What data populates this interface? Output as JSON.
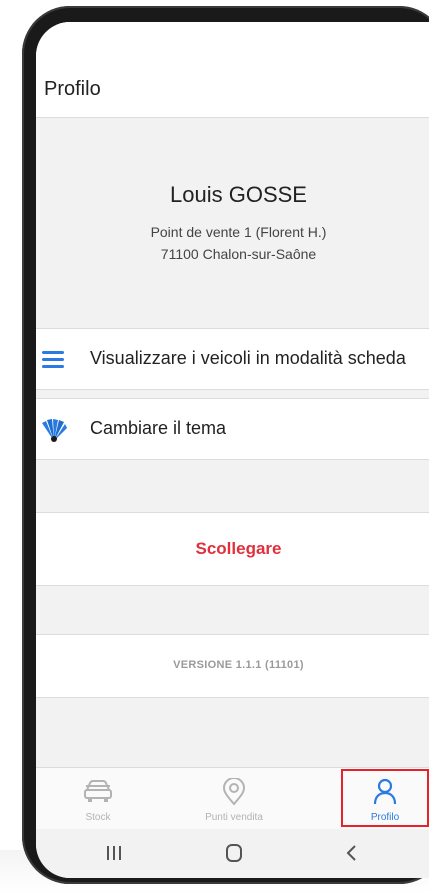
{
  "header": {
    "title": "Profilo"
  },
  "profile": {
    "name": "Louis GOSSE",
    "store": "Point de vente 1 (Florent H.)",
    "city": "71100 Chalon-sur-Saône"
  },
  "menu": [
    {
      "label": "Visualizzare i veicoli in modalità scheda",
      "icon": "hamburger-list-icon"
    },
    {
      "label": "Cambiare il tema",
      "icon": "palette-fan-icon"
    }
  ],
  "actions": {
    "disconnect": "Scollegare"
  },
  "version": "VERSIONE 1.1.1 (11101)",
  "tabs": [
    {
      "label": "Stock",
      "icon": "car-icon",
      "active": false
    },
    {
      "label": "Punti vendita",
      "icon": "location-pin-icon",
      "active": false
    },
    {
      "label": "Profilo",
      "icon": "user-icon",
      "active": true
    }
  ],
  "colors": {
    "accent": "#2a7ae2",
    "danger": "#e0303c",
    "highlight": "#e5232b",
    "background": "#f2f2f2"
  }
}
